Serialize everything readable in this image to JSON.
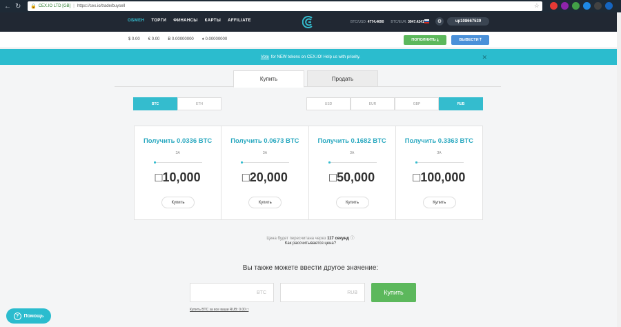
{
  "browser": {
    "site": "CEX.IO LTD [GB]",
    "url": "https://cex.io/trade/buysell",
    "extensions": [
      "#e53935",
      "#8e24aa",
      "#43a047",
      "#1e88e5",
      "#424242",
      "#1565c0"
    ]
  },
  "header": {
    "menu": [
      "ОБМЕН",
      "ТОРГИ",
      "ФИНАНСЫ",
      "КАРТЫ",
      "AFFILIATE"
    ],
    "rate1_label": "BTC/USD:",
    "rate1_value": "4774.4690",
    "rate2_label": "BTC/EUR:",
    "rate2_value": "3947.4241",
    "account": "up108667539"
  },
  "balances": [
    "$ 0.00",
    "€ 0.00",
    "Ƀ 0.00000000",
    "♦ 0.00000000"
  ],
  "actions": {
    "deposit": "ПОПОЛНИТЬ",
    "withdraw": "ВЫВЕСТИ"
  },
  "banner": {
    "link": "Vote",
    "text": "for NEW tokens on CEX.IO! Help us with priority."
  },
  "tabs": [
    "Купить",
    "Продать"
  ],
  "crypto_toggle": [
    "BTC",
    "ETH"
  ],
  "fiat_toggle": [
    "USD",
    "EUR",
    "GBP",
    "RUB"
  ],
  "cards": [
    {
      "get": "Получить 0.0336 BTC",
      "za": "ЗА",
      "amount": "□10,000",
      "buy": "Купить"
    },
    {
      "get": "Получить 0.0673 BTC",
      "za": "ЗА",
      "amount": "□20,000",
      "buy": "Купить"
    },
    {
      "get": "Получить 0.1682 BTC",
      "za": "ЗА",
      "amount": "□50,000",
      "buy": "Купить"
    },
    {
      "get": "Получить 0.3363 BTC",
      "za": "ЗА",
      "amount": "□100,000",
      "buy": "Купить"
    }
  ],
  "recalc": {
    "text": "Цена будет пересчитана через",
    "seconds": "117 секунд"
  },
  "how_calc": "Как рассчитывается цена?",
  "other_value": "Вы также можете ввести другое значение:",
  "inputs": {
    "btc_placeholder": "BTC",
    "rub_placeholder": "RUB"
  },
  "buy_big": "Купить",
  "note": "Купить BTC за все ваши RUB: 0.00 □",
  "help": "Помощь"
}
